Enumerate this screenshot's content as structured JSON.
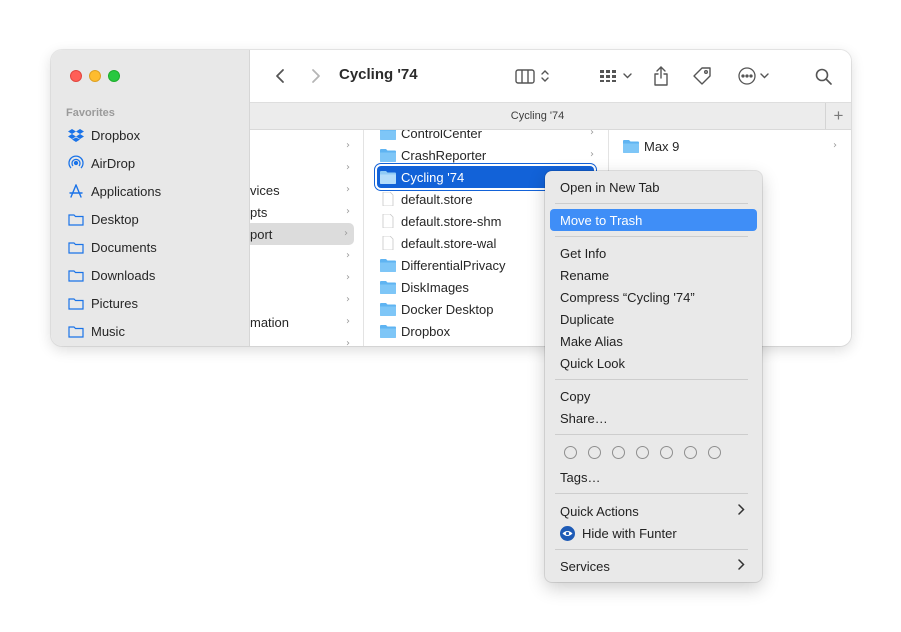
{
  "toolbar": {
    "title": "Cycling '74",
    "tab_title": "Cycling '74",
    "add_tab": "+"
  },
  "sidebar": {
    "heading": "Favorites",
    "items": [
      {
        "label": "Dropbox",
        "icon": "dropbox-icon"
      },
      {
        "label": "AirDrop",
        "icon": "airdrop-icon"
      },
      {
        "label": "Applications",
        "icon": "applications-icon"
      },
      {
        "label": "Desktop",
        "icon": "folder-icon"
      },
      {
        "label": "Documents",
        "icon": "folder-icon"
      },
      {
        "label": "Downloads",
        "icon": "folder-icon"
      },
      {
        "label": "Pictures",
        "icon": "folder-icon"
      },
      {
        "label": "Music",
        "icon": "folder-icon"
      }
    ]
  },
  "column1": {
    "items": [
      {
        "label": ""
      },
      {
        "label": ""
      },
      {
        "label": "vices"
      },
      {
        "label": "pts"
      },
      {
        "label": "port"
      },
      {
        "label": ""
      },
      {
        "label": ""
      },
      {
        "label": ""
      },
      {
        "label": "mation"
      },
      {
        "label": ""
      }
    ]
  },
  "column2": {
    "items": [
      {
        "label": "ControlCenter",
        "type": "folder"
      },
      {
        "label": "CrashReporter",
        "type": "folder"
      },
      {
        "label": "Cycling '74",
        "type": "folder"
      },
      {
        "label": "default.store",
        "type": "file"
      },
      {
        "label": "default.store-shm",
        "type": "file"
      },
      {
        "label": "default.store-wal",
        "type": "file"
      },
      {
        "label": "DifferentialPrivacy",
        "type": "folder"
      },
      {
        "label": "DiskImages",
        "type": "folder"
      },
      {
        "label": "Docker Desktop",
        "type": "folder"
      },
      {
        "label": "Dropbox",
        "type": "folder"
      }
    ]
  },
  "column3": {
    "items": [
      {
        "label": "Max 9",
        "type": "folder"
      }
    ]
  },
  "context_menu": {
    "open_in_new_tab": "Open in New Tab",
    "move_to_trash": "Move to Trash",
    "get_info": "Get Info",
    "rename": "Rename",
    "compress": "Compress “Cycling '74”",
    "duplicate": "Duplicate",
    "make_alias": "Make Alias",
    "quick_look": "Quick Look",
    "copy": "Copy",
    "share": "Share…",
    "tags": "Tags…",
    "quick_actions": "Quick Actions",
    "hide_with_funter": "Hide with Funter",
    "services": "Services"
  },
  "colors": {
    "selection_blue": "#1262d8",
    "menu_highlight": "#3f8ef7",
    "folder_blue": "#5fb4f2"
  }
}
